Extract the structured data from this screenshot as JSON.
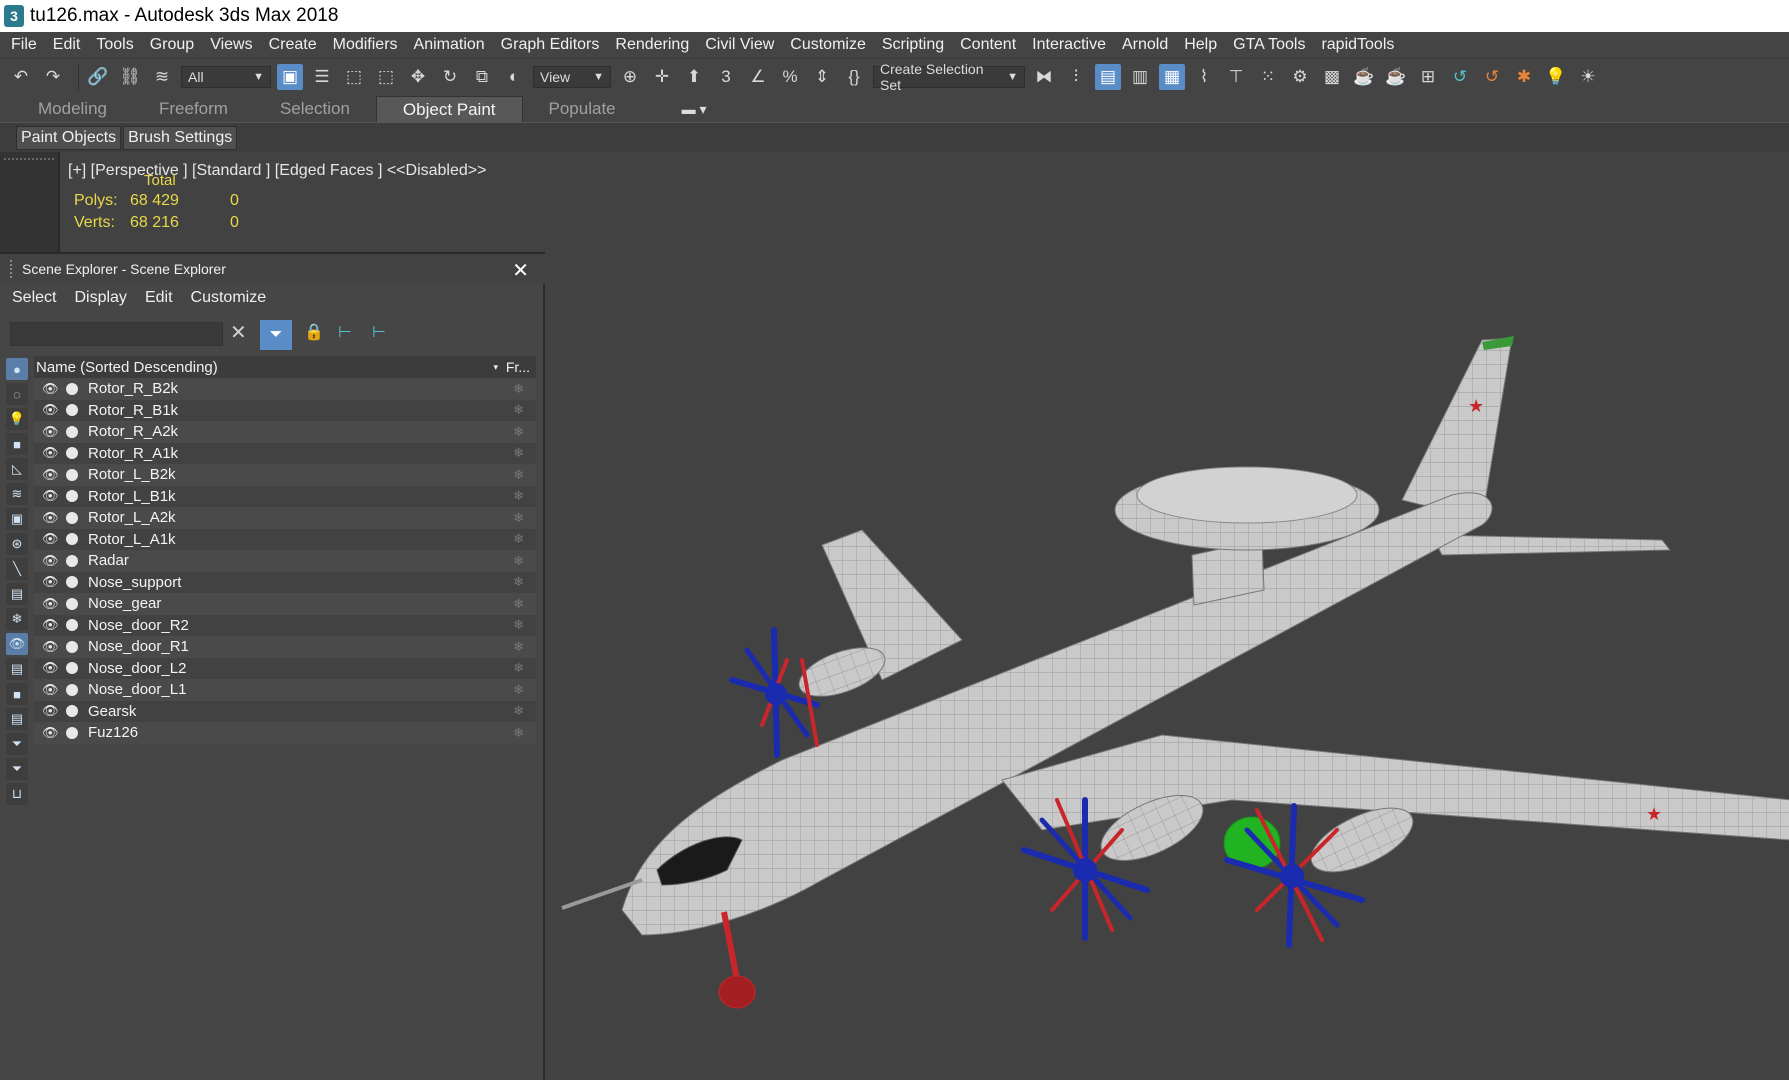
{
  "window": {
    "title": "tu126.max - Autodesk 3ds Max 2018",
    "app_icon": "3"
  },
  "menu": [
    "File",
    "Edit",
    "Tools",
    "Group",
    "Views",
    "Create",
    "Modifiers",
    "Animation",
    "Graph Editors",
    "Rendering",
    "Civil View",
    "Customize",
    "Scripting",
    "Content",
    "Interactive",
    "Arnold",
    "Help",
    "GTA Tools",
    "rapidTools"
  ],
  "toolbar": {
    "filter_value": "All",
    "ref_coord_value": "View",
    "selection_set_placeholder": "Create Selection Set"
  },
  "ribbon": {
    "tabs": [
      "Modeling",
      "Freeform",
      "Selection",
      "Object Paint",
      "Populate"
    ],
    "active_tab": "Object Paint",
    "buttons": [
      "Paint Objects",
      "Brush Settings"
    ]
  },
  "viewport": {
    "label": "[+] [Perspective ]  [Standard ] [Edged Faces ]  <<Disabled>>",
    "stats": {
      "total_label": "Total",
      "polys_label": "Polys:",
      "polys_total": "68 429",
      "polys_sel": "0",
      "verts_label": "Verts:",
      "verts_total": "68 216",
      "verts_sel": "0"
    }
  },
  "scene_explorer": {
    "title": "Scene Explorer - Scene Explorer",
    "menu": [
      "Select",
      "Display",
      "Edit",
      "Customize"
    ],
    "column_name": "Name (Sorted Descending)",
    "column_frozen": "Fr...",
    "items": [
      "Rotor_R_B2k",
      "Rotor_R_B1k",
      "Rotor_R_A2k",
      "Rotor_R_A1k",
      "Rotor_L_B2k",
      "Rotor_L_B1k",
      "Rotor_L_A2k",
      "Rotor_L_A1k",
      "Radar",
      "Nose_support",
      "Nose_gear",
      "Nose_door_R2",
      "Nose_door_R1",
      "Nose_door_L2",
      "Nose_door_L1",
      "Gearsk",
      "Fuz126"
    ]
  },
  "colors": {
    "accent": "#5a8cc8",
    "stats": "#e8d84a",
    "selected_red": "#c8262a",
    "selected_blue": "#1a2bb0",
    "selected_green": "#22b322"
  }
}
